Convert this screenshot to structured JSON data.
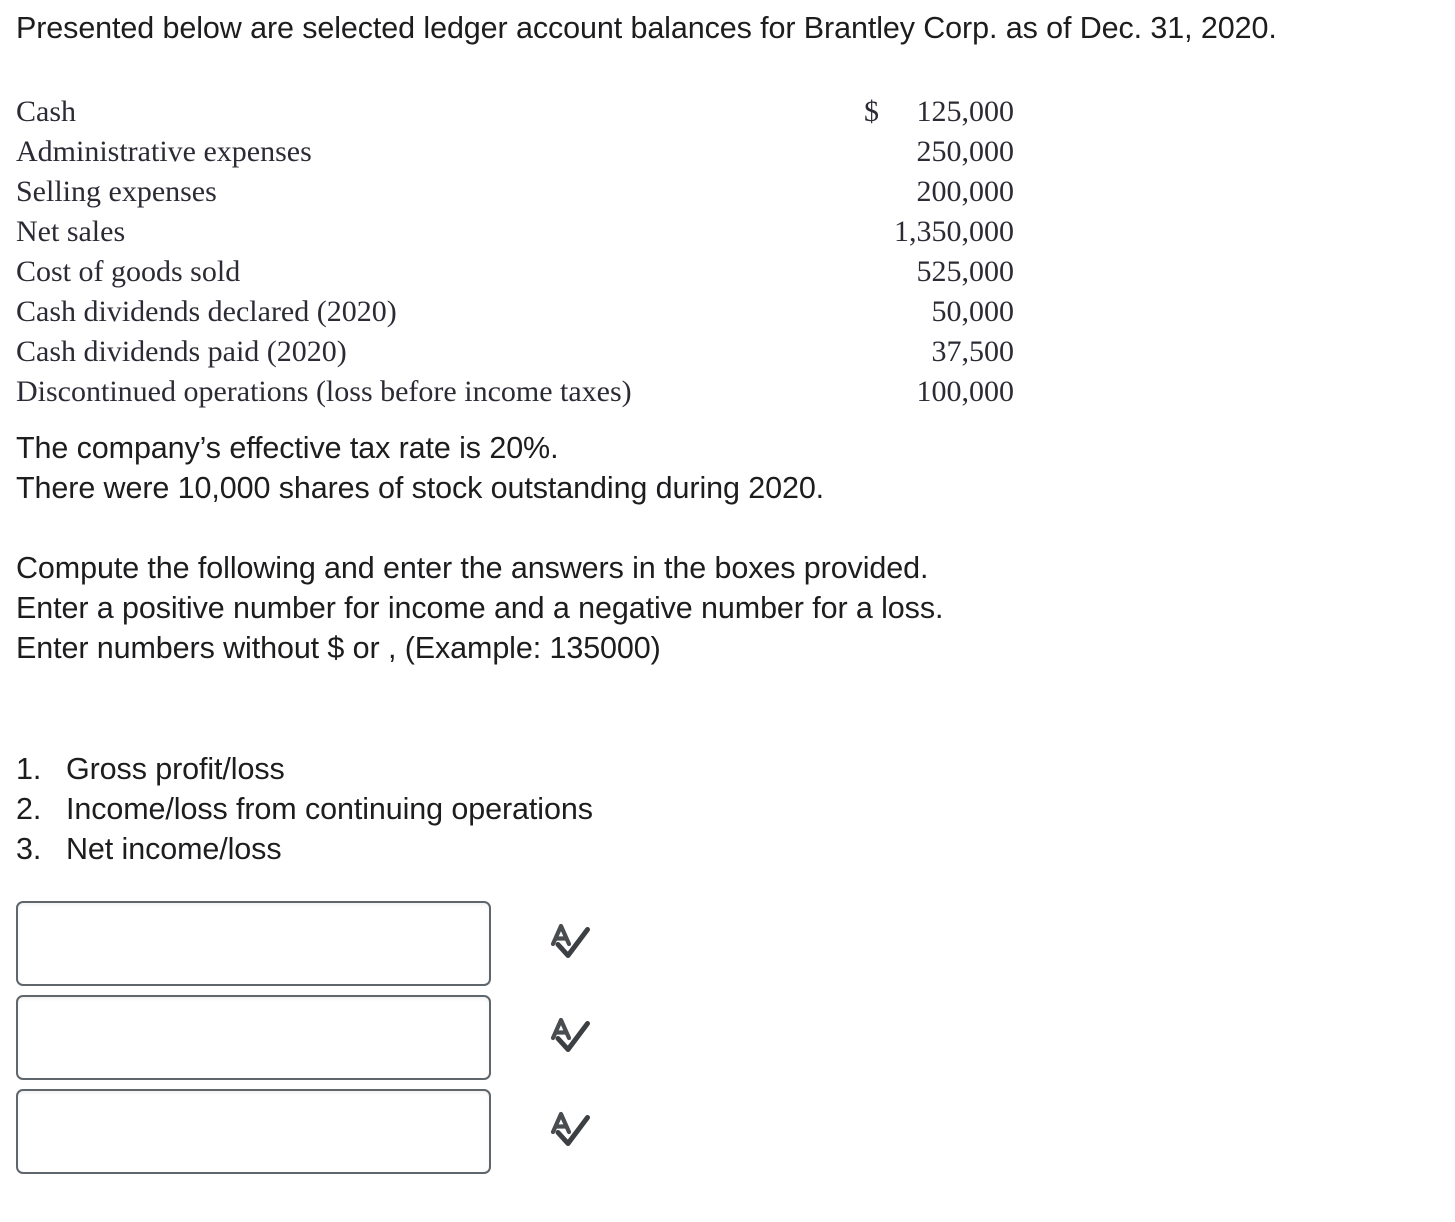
{
  "problem": {
    "intro": "Presented below are selected ledger account balances for Brantley Corp. as of Dec. 31, 2020.",
    "ledger": {
      "currency_symbol": "$",
      "rows": [
        {
          "label": "Cash",
          "amount": "125,000"
        },
        {
          "label": "Administrative expenses",
          "amount": "250,000"
        },
        {
          "label": "Selling expenses",
          "amount": "200,000"
        },
        {
          "label": "Net sales",
          "amount": "1,350,000"
        },
        {
          "label": "Cost of goods sold",
          "amount": "525,000"
        },
        {
          "label": "Cash dividends declared (2020)",
          "amount": "50,000"
        },
        {
          "label": "Cash dividends paid (2020)",
          "amount": "37,500"
        },
        {
          "label": "Discontinued operations (loss before income taxes)",
          "amount": "100,000"
        }
      ]
    },
    "notes": [
      "The company’s effective tax rate is 20%.",
      "There were 10,000 shares of stock outstanding during 2020."
    ],
    "instructions": [
      "Compute the following and enter the answers in the boxes provided.",
      "Enter a positive number for income and a negative number for a loss.",
      "Enter numbers without $ or , (Example: 135000)"
    ],
    "tasks": [
      {
        "number": "1.",
        "text": "Gross profit/loss"
      },
      {
        "number": "2.",
        "text": "Income/loss from continuing operations"
      },
      {
        "number": "3.",
        "text": "Net income/loss"
      }
    ]
  },
  "answers": {
    "fields": [
      {
        "value": "",
        "placeholder": ""
      },
      {
        "value": "",
        "placeholder": ""
      },
      {
        "value": "",
        "placeholder": ""
      }
    ],
    "icon": "spellcheck-icon"
  },
  "colors": {
    "page_background": "#ffffff",
    "sans_text": "#1d1d1f",
    "serif_text": "#2b2b35",
    "input_border": "#5f666c",
    "icon": "#4a4d50"
  }
}
